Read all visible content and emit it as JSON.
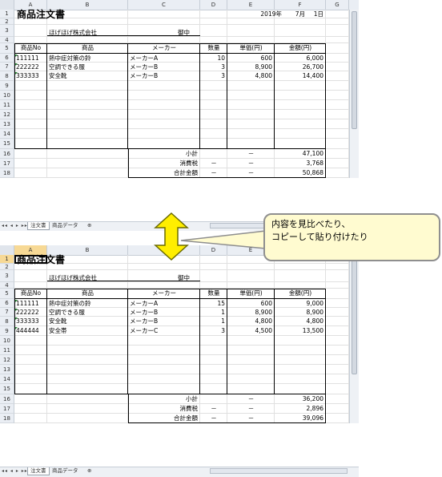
{
  "columns": [
    "A",
    "B",
    "C",
    "D",
    "E",
    "F",
    "G"
  ],
  "top": {
    "selected_col": "",
    "selected_row": "",
    "title": "商品注文書",
    "date_year": "2019年",
    "date_month": "7月",
    "date_day": "1日",
    "customer": "ほげほげ株式会社",
    "honorific": "御中",
    "headers": {
      "code": "商品No",
      "name": "商品",
      "maker": "メーカー",
      "qty": "数量",
      "unit": "単価(円)",
      "amount": "金額(円)"
    },
    "items": [
      {
        "code": "111111",
        "name": "熱中症対策の鈴",
        "maker": "メーカーA",
        "qty": "10",
        "unit": "600",
        "amount": "6,000"
      },
      {
        "code": "222222",
        "name": "空調できる服",
        "maker": "メーカーB",
        "qty": "3",
        "unit": "8,900",
        "amount": "26,700"
      },
      {
        "code": "333333",
        "name": "安全靴",
        "maker": "メーカーB",
        "qty": "3",
        "unit": "4,800",
        "amount": "14,400"
      }
    ],
    "summary": [
      {
        "label": "小計",
        "qty": "",
        "unit": "－",
        "amount": "47,100"
      },
      {
        "label": "消費税",
        "qty": "－",
        "unit": "－",
        "amount": "3,768"
      },
      {
        "label": "合計金額",
        "qty": "－",
        "unit": "－",
        "amount": "50,868"
      }
    ],
    "tabs": [
      "注文書",
      "商品データ"
    ]
  },
  "bottom": {
    "selected_col": "A",
    "selected_row": "1",
    "title": "商品注文書",
    "customer": "ほげほげ株式会社",
    "honorific": "御中",
    "headers": {
      "code": "商品No",
      "name": "商品",
      "maker": "メーカー",
      "qty": "数量",
      "unit": "単価(円)",
      "amount": "金額(円)"
    },
    "items": [
      {
        "code": "111111",
        "name": "熱中症対策の鈴",
        "maker": "メーカーA",
        "qty": "15",
        "unit": "600",
        "amount": "9,000"
      },
      {
        "code": "222222",
        "name": "空調できる服",
        "maker": "メーカーB",
        "qty": "1",
        "unit": "8,900",
        "amount": "8,900"
      },
      {
        "code": "333333",
        "name": "安全靴",
        "maker": "メーカーB",
        "qty": "1",
        "unit": "4,800",
        "amount": "4,800"
      },
      {
        "code": "444444",
        "name": "安全帯",
        "maker": "メーカーC",
        "qty": "3",
        "unit": "4,500",
        "amount": "13,500"
      }
    ],
    "summary": [
      {
        "label": "小計",
        "qty": "",
        "unit": "－",
        "amount": "36,200"
      },
      {
        "label": "消費税",
        "qty": "－",
        "unit": "－",
        "amount": "2,896"
      },
      {
        "label": "合計金額",
        "qty": "－",
        "unit": "－",
        "amount": "39,096"
      }
    ],
    "tabs": [
      "注文書",
      "商品データ"
    ]
  },
  "callout": {
    "line1": "内容を見比べたり、",
    "line2": "コピーして貼り付けたり"
  },
  "arrow_color": "#ffee00",
  "arrow_stroke": "#6b6b00"
}
